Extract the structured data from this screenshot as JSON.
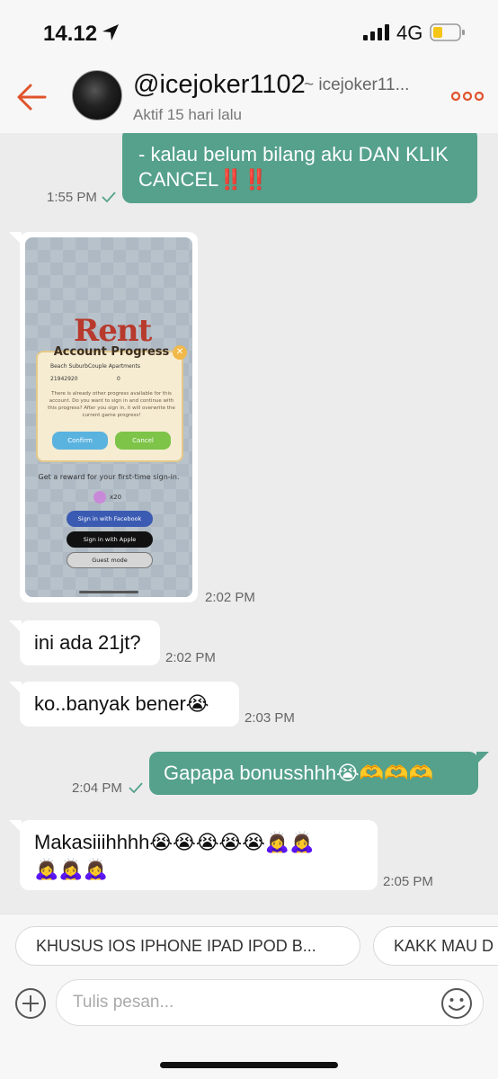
{
  "status_bar": {
    "time": "14.12",
    "network": "4G"
  },
  "header": {
    "username": "@icejoker1102",
    "username_alt": "~ icejoker11...",
    "active_status": "Aktif 15 hari lalu"
  },
  "messages": [
    {
      "dir": "out",
      "text": "- kalau belum bilang aku DAN KLIK CANCEL‼️‼️",
      "time": "1:55 PM",
      "read": true
    },
    {
      "dir": "in",
      "type": "image",
      "time": "2:02 PM",
      "image": {
        "logo": "Rent",
        "dialog_title": "Account Progress",
        "apartment": "Beach SuburbCouple Apartments",
        "cash": "21942920",
        "extra": "0",
        "message": "There is already other progress available for this account. Do you want to sign in and continue with this progress? After you sign in, it will overwrite the current game progress!",
        "confirm": "Confirm",
        "cancel": "Cancel",
        "reward_text": "Get a reward for your first-time sign-in.",
        "reward_count": "x20",
        "facebook": "Sign in with Facebook",
        "apple": "Sign in with Apple",
        "guest": "Guest mode"
      }
    },
    {
      "dir": "in",
      "text": "ini ada 21jt?",
      "time": "2:02 PM"
    },
    {
      "dir": "in",
      "text": "ko..banyak bener😭",
      "time": "2:03 PM"
    },
    {
      "dir": "out",
      "text": "Gapapa bonusshhh😭🫶🫶🫶",
      "time": "2:04 PM",
      "read": true
    },
    {
      "dir": "in",
      "text": "Makasiiihhhh😭😭😭😭😭🙇‍♀️🙇‍♀️🙇‍♀️🙇‍♀️🙇‍♀️",
      "line1": "Makasiiihhhh😭😭😭😭😭🙇‍♀️🙇‍♀️",
      "line2": "🙇‍♀️🙇‍♀️🙇‍♀️",
      "time": "2:05 PM"
    }
  ],
  "quick_replies": [
    "KHUSUS IOS IPHONE IPAD IPOD B...",
    "KAKK MAU D"
  ],
  "input": {
    "placeholder": "Tulis pesan..."
  },
  "colors": {
    "accent": "#e0532b",
    "outgoing_bubble": "#55a18b",
    "incoming_bubble": "#ffffff",
    "background": "#ececec"
  },
  "icons": [
    "location-arrow-icon",
    "signal-icon",
    "battery-icon",
    "back-arrow-icon",
    "more-dots-icon",
    "check-icon",
    "plus-icon",
    "emoji-icon"
  ]
}
